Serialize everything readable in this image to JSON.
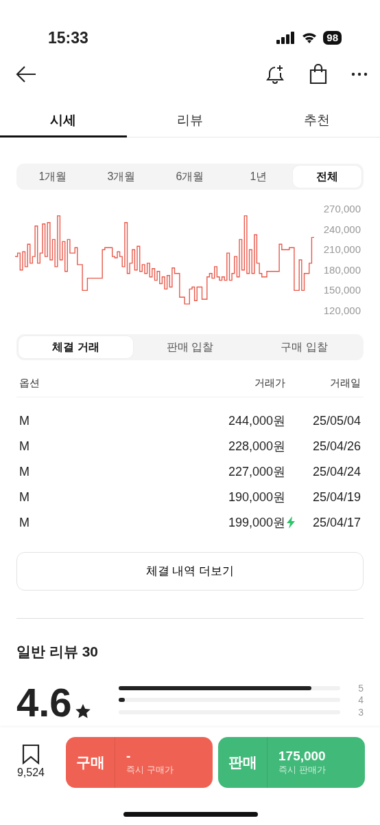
{
  "status_bar": {
    "time": "15:33",
    "battery": "98"
  },
  "tabs": [
    {
      "label": "시세",
      "selected": true
    },
    {
      "label": "리뷰",
      "selected": false
    },
    {
      "label": "추천",
      "selected": false
    }
  ],
  "periods": [
    {
      "label": "1개월",
      "selected": false
    },
    {
      "label": "3개월",
      "selected": false
    },
    {
      "label": "6개월",
      "selected": false
    },
    {
      "label": "1년",
      "selected": false
    },
    {
      "label": "전체",
      "selected": true
    }
  ],
  "price_chart": {
    "chart_data": {
      "type": "line",
      "ylim": [
        120000,
        270000
      ],
      "yticks": [
        {
          "value": 270000,
          "label": "270,000"
        },
        {
          "value": 240000,
          "label": "240,000"
        },
        {
          "value": 210000,
          "label": "210,000"
        },
        {
          "value": 180000,
          "label": "180,000"
        },
        {
          "value": 150000,
          "label": "150,000"
        },
        {
          "value": 120000,
          "label": "120,000"
        }
      ],
      "series": [
        {
          "color": "#e8584a",
          "values": [
            200000,
            205000,
            180000,
            207000,
            185000,
            218000,
            190000,
            200000,
            245000,
            190000,
            205000,
            248000,
            200000,
            250000,
            195000,
            225000,
            185000,
            260000,
            195000,
            222000,
            178000,
            225000,
            205000,
            205000,
            213000,
            188000,
            188000,
            150000,
            150000,
            168000,
            168000,
            168000,
            168000,
            168000,
            168000,
            210000,
            213000,
            213000,
            213000,
            200000,
            198000,
            207000,
            200000,
            185000,
            250000,
            175000,
            190000,
            210000,
            180000,
            215000,
            178000,
            188000,
            175000,
            190000,
            170000,
            182000,
            165000,
            178000,
            160000,
            170000,
            152000,
            172000,
            155000,
            183000,
            175000,
            175000,
            140000,
            140000,
            130000,
            130000,
            152000,
            155000,
            135000,
            155000,
            155000,
            137000,
            137000,
            170000,
            175000,
            168000,
            185000,
            170000,
            165000,
            170000,
            165000,
            205000,
            165000,
            175000,
            200000,
            170000,
            225000,
            180000,
            260000,
            175000,
            210000,
            175000,
            232000,
            190000,
            175000,
            170000,
            170000,
            178000,
            178000,
            178000,
            178000,
            178000,
            218000,
            210000,
            210000,
            210000,
            213000,
            213000,
            150000,
            150000,
            195000,
            150000,
            175000,
            175000,
            190000,
            228000,
            228000
          ]
        }
      ]
    }
  },
  "trade_tabs": [
    {
      "label": "체결 거래",
      "selected": true
    },
    {
      "label": "판매 입찰",
      "selected": false
    },
    {
      "label": "구매 입찰",
      "selected": false
    }
  ],
  "table": {
    "columns": [
      "옵션",
      "거래가",
      "거래일"
    ],
    "rows": [
      {
        "option": "M",
        "price": "244,000원",
        "date": "25/05/04",
        "instant": false
      },
      {
        "option": "M",
        "price": "228,000원",
        "date": "25/04/26",
        "instant": false
      },
      {
        "option": "M",
        "price": "227,000원",
        "date": "25/04/24",
        "instant": false
      },
      {
        "option": "M",
        "price": "190,000원",
        "date": "25/04/19",
        "instant": false
      },
      {
        "option": "M",
        "price": "199,000원",
        "date": "25/04/17",
        "instant": true
      }
    ]
  },
  "more_button": "체결 내역 더보기",
  "reviews": {
    "title": "일반 리뷰 30",
    "rating": "4.6",
    "bars": [
      {
        "label": "5",
        "level": 0.87
      },
      {
        "label": "4",
        "level": 0.03
      },
      {
        "label": "3"
      }
    ]
  },
  "bottom_bar": {
    "bookmark_count": "9,524",
    "actions": [
      {
        "kind": "buy",
        "label": "구매",
        "price": "-",
        "caption": "즉시 구매가"
      },
      {
        "kind": "sell",
        "label": "판매",
        "price": "175,000",
        "caption": "즉시 판매가"
      }
    ]
  }
}
